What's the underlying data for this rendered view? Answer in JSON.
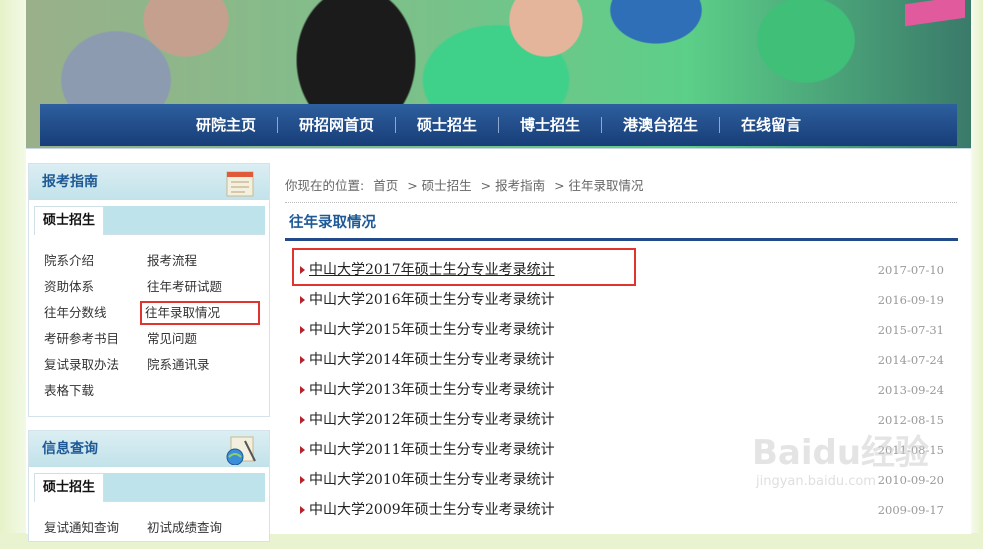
{
  "nav": {
    "items": [
      "研院主页",
      "研招网首页",
      "硕士招生",
      "博士招生",
      "港澳台招生",
      "在线留言"
    ]
  },
  "sidebar": {
    "box1": {
      "title": "报考指南",
      "tab": "硕士招生",
      "links": [
        "院系介绍",
        "报考流程",
        "资助体系",
        "往年考研试题",
        "往年分数线",
        "往年录取情况",
        "考研参考书目",
        "常见问题",
        "复试录取办法",
        "院系通讯录",
        "表格下载"
      ],
      "highlighted": "往年录取情况"
    },
    "box2": {
      "title": "信息查询",
      "tab": "硕士招生",
      "links": [
        "复试通知查询",
        "初试成绩查询"
      ]
    }
  },
  "breadcrumb": {
    "prefix": "你现在的位置:",
    "items": [
      "首页",
      "> 硕士招生",
      "> 报考指南",
      "> 往年录取情况"
    ]
  },
  "main": {
    "title": "往年录取情况",
    "list": [
      {
        "title": "中山大学2017年硕士生分专业考录统计",
        "date": "2017-07-10"
      },
      {
        "title": "中山大学2016年硕士生分专业考录统计",
        "date": "2016-09-19"
      },
      {
        "title": "中山大学2015年硕士生分专业考录统计",
        "date": "2015-07-31"
      },
      {
        "title": "中山大学2014年硕士生分专业考录统计",
        "date": "2014-07-24"
      },
      {
        "title": "中山大学2013年硕士生分专业考录统计",
        "date": "2013-09-24"
      },
      {
        "title": "中山大学2012年硕士生分专业考录统计",
        "date": "2012-08-15"
      },
      {
        "title": "中山大学2011年硕士生分专业考录统计",
        "date": "2011-08-15"
      },
      {
        "title": "中山大学2010年硕士生分专业考录统计",
        "date": "2010-09-20"
      },
      {
        "title": "中山大学2009年硕士生分专业考录统计",
        "date": "2009-09-17"
      }
    ]
  },
  "watermark": {
    "logo": "Baidu经验",
    "url": "jingyan.baidu.com"
  },
  "colors": {
    "nav_bg": "#1f4a87",
    "accent_blue": "#1f5a96",
    "highlight_red": "#e0342f",
    "arrow_red": "#b8232a"
  }
}
